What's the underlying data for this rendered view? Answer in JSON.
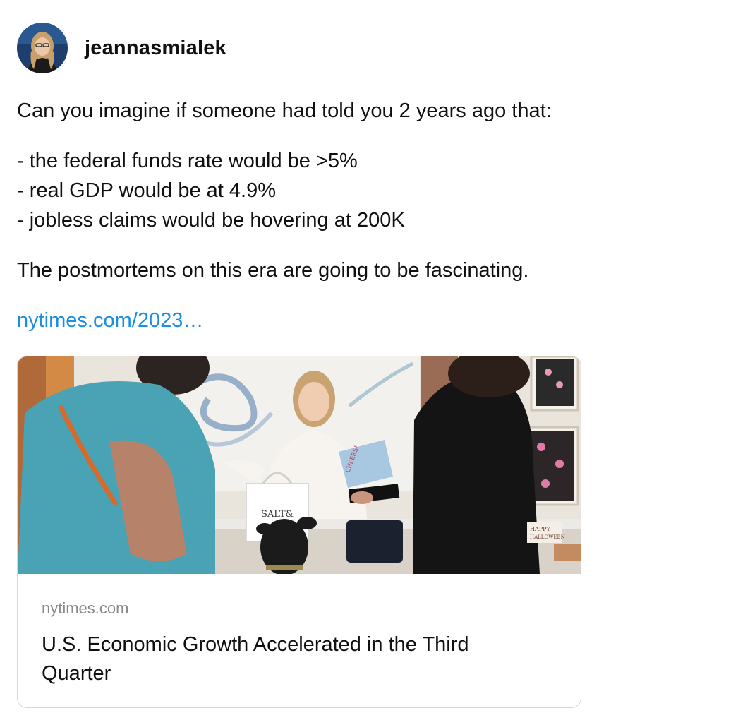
{
  "post": {
    "author": {
      "username": "jeannasmialek"
    },
    "paragraphs": [
      [
        "Can you imagine if someone had told you 2 years ago that:"
      ],
      [
        "- the federal funds rate would be >5%",
        "- real GDP would be at 4.9%",
        "- jobless claims would be hovering at 200K"
      ],
      [
        "The postmortems on this era are going to be fascinating."
      ]
    ],
    "link_text": "nytimes.com/2023…",
    "link_color": "#1a8fe0"
  },
  "link_card": {
    "image_sign_text": "SALT&",
    "image_card_text": "CHEERS!",
    "image_decor_text": [
      "HAPPY",
      "HALLOWEEN"
    ],
    "domain": "nytimes.com",
    "title": "U.S. Economic Growth Accelerated in the Third Quarter"
  }
}
